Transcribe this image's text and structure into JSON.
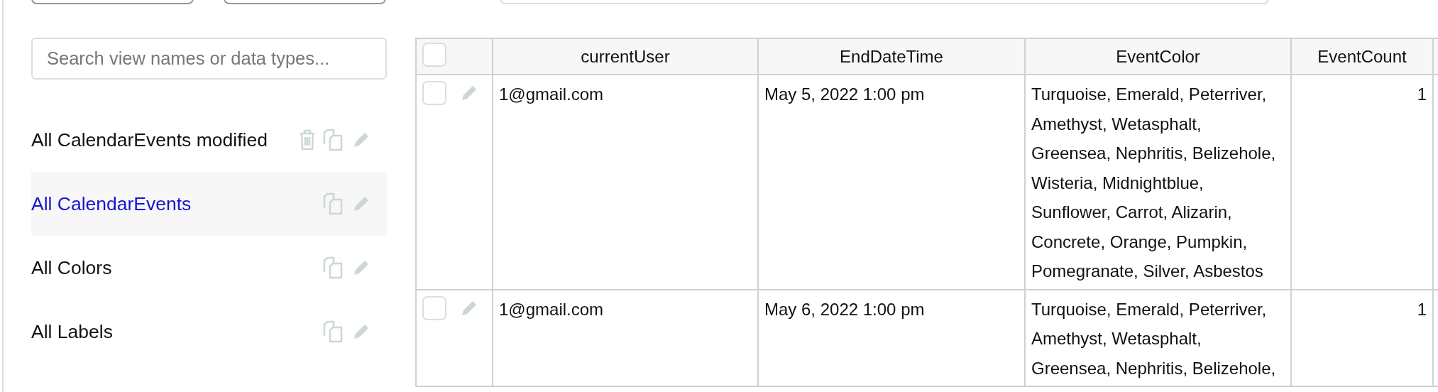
{
  "search": {
    "placeholder": "Search view names or data types..."
  },
  "views": [
    {
      "label": "All CalendarEvents modified",
      "selected": false,
      "deletable": true
    },
    {
      "label": "All CalendarEvents",
      "selected": true,
      "deletable": false
    },
    {
      "label": "All Colors",
      "selected": false,
      "deletable": false
    },
    {
      "label": "All Labels",
      "selected": false,
      "deletable": false
    }
  ],
  "table": {
    "select_all_checked": false,
    "columns": [
      {
        "label": "currentUser"
      },
      {
        "label": "EndDateTime"
      },
      {
        "label": "EventColor"
      },
      {
        "label": "EventCount"
      }
    ],
    "rows": [
      {
        "checked": false,
        "cells": [
          "1@gmail.com",
          "May 5, 2022 1:00 pm",
          "Turquoise, Emerald, Peterriver, Amethyst, Wetasphalt, Greensea, Nephritis, Belizehole, Wisteria, Midnightblue, Sunflower, Carrot, Alizarin, Concrete, Orange, Pumpkin, Pomegranate, Silver, Asbestos",
          "1"
        ]
      },
      {
        "checked": false,
        "cells": [
          "1@gmail.com",
          "May 6, 2022 1:00 pm",
          "Turquoise, Emerald, Peterriver, Amethyst, Wetasphalt, Greensea, Nephritis, Belizehole,",
          "1"
        ]
      }
    ]
  }
}
